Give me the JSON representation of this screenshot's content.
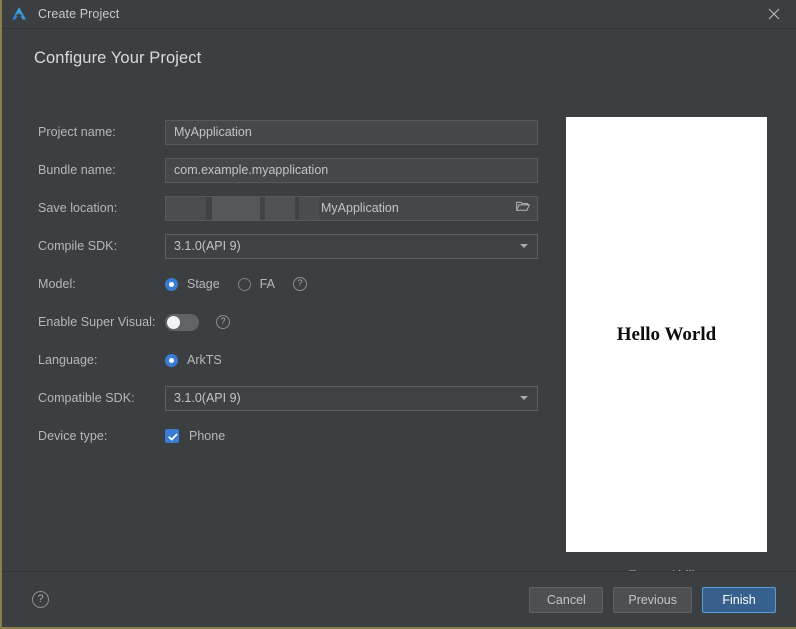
{
  "window": {
    "title": "Create Project",
    "logo_icon": "deveco-logo-icon",
    "close_icon": "close-icon"
  },
  "heading": "Configure Your Project",
  "form": {
    "project_name": {
      "label": "Project name:",
      "value": "MyApplication"
    },
    "bundle_name": {
      "label": "Bundle name:",
      "value": "com.example.myapplication"
    },
    "save_location": {
      "label": "Save location:",
      "value": "MyApplication",
      "browse_icon": "folder-open-icon"
    },
    "compile_sdk": {
      "label": "Compile SDK:",
      "value": "3.1.0(API 9)",
      "caret_icon": "chevron-down-icon"
    },
    "model": {
      "label": "Model:",
      "selected": "Stage",
      "options": [
        "Stage",
        "FA"
      ],
      "help_icon": "question-mark-icon",
      "help_glyph": "?"
    },
    "enable_super_visual": {
      "label": "Enable Super Visual:",
      "state": "off",
      "help_icon": "question-mark-icon",
      "help_glyph": "?"
    },
    "language": {
      "label": "Language:",
      "selected": "ArkTS",
      "options": [
        "ArkTS"
      ]
    },
    "compatible_sdk": {
      "label": "Compatible SDK:",
      "value": "3.1.0(API 9)",
      "caret_icon": "chevron-down-icon"
    },
    "device_type": {
      "label": "Device type:",
      "options": [
        {
          "label": "Phone",
          "checked": true
        }
      ]
    }
  },
  "preview": {
    "screen_text": "Hello World",
    "caption": "Empty Ability"
  },
  "footer": {
    "help_icon": "question-mark-icon",
    "help_glyph": "?",
    "cancel_label": "Cancel",
    "previous_label": "Previous",
    "finish_label": "Finish"
  },
  "colors": {
    "accent": "#3a7cd4",
    "primary_button": "#36618f",
    "window_bg": "#3c3f41",
    "frame_border": "#8a7f4a"
  }
}
